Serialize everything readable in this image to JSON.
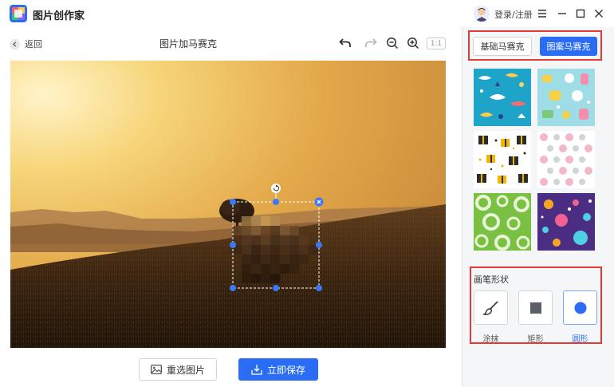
{
  "app": {
    "title": "图片创作家"
  },
  "header": {
    "login_label": "登录/注册"
  },
  "editor": {
    "back_label": "返回",
    "page_title": "图片加马赛克",
    "zoom_reset_label": "1:1"
  },
  "actions": {
    "reselect_label": "重选图片",
    "save_label": "立即保存"
  },
  "panel": {
    "tabs": [
      {
        "label": "基础马赛克",
        "active": false
      },
      {
        "label": "图案马赛克",
        "active": true
      }
    ],
    "patterns": [
      "ocean-pattern",
      "baby-pattern",
      "gift-pattern",
      "pink-dots-pattern",
      "green-rings-pattern",
      "purple-bubbles-pattern"
    ],
    "brush_section_title": "画笔形状",
    "brushes": [
      {
        "label": "涂抹",
        "icon": "brush-icon",
        "active": false
      },
      {
        "label": "矩形",
        "icon": "square-icon",
        "active": false
      },
      {
        "label": "圆形",
        "icon": "circle-icon",
        "active": true
      }
    ]
  },
  "colors": {
    "accent": "#2a6df4",
    "highlight": "#e53935",
    "panel_bg": "#f5f6f8"
  }
}
